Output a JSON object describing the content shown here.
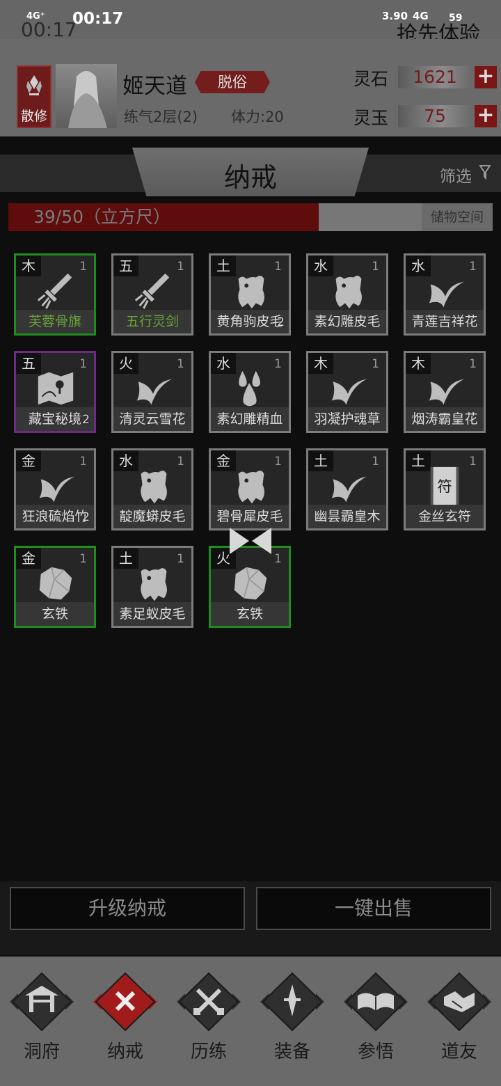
{
  "status_bar": {
    "signal": "4G⁺",
    "time": "00:17",
    "overlay_time": "00:17",
    "speed": "3.90",
    "network": "4G",
    "battery": "59",
    "banner": "抢先体验"
  },
  "player": {
    "sect": "散修",
    "name": "姬天道",
    "rank": "脱俗",
    "realm": "练气2层(2)",
    "stamina": "体力:20"
  },
  "currency": {
    "lingshi": {
      "label": "灵石",
      "value": "1621"
    },
    "lingyu": {
      "label": "灵玉",
      "value": "75"
    }
  },
  "ring": {
    "title": "纳戒",
    "filter_label": "筛选",
    "capacity_text": "39/50（立方尺）",
    "capacity_used": 39,
    "capacity_total": 50,
    "storage_label": "储物空间"
  },
  "items": [
    {
      "element": "木",
      "qty": "1",
      "name": "芙蓉骨旗",
      "icon": "sword-icon",
      "border": "green",
      "name_color": "green"
    },
    {
      "element": "五",
      "qty": "1",
      "name": "五行灵剑",
      "icon": "sword-icon",
      "border": "gray",
      "name_color": "green"
    },
    {
      "element": "土",
      "qty": "1",
      "name": "黄角驹皮毛",
      "icon": "pelt-icon",
      "border": "gray",
      "stack": "2"
    },
    {
      "element": "水",
      "qty": "1",
      "name": "素幻雕皮毛",
      "icon": "pelt-icon",
      "border": "gray"
    },
    {
      "element": "水",
      "qty": "1",
      "name": "青莲吉祥花",
      "icon": "leaf-icon",
      "border": "gray"
    },
    {
      "element": "五",
      "qty": "1",
      "name": "藏宝秘境",
      "icon": "map-icon",
      "border": "purple",
      "stack": "2"
    },
    {
      "element": "火",
      "qty": "1",
      "name": "清灵云雪花",
      "icon": "leaf-icon",
      "border": "gray"
    },
    {
      "element": "水",
      "qty": "1",
      "name": "素幻雕精血",
      "icon": "blood-icon",
      "border": "gray"
    },
    {
      "element": "木",
      "qty": "1",
      "name": "羽凝护魂草",
      "icon": "leaf-icon",
      "border": "gray"
    },
    {
      "element": "木",
      "qty": "1",
      "name": "烟涛霸皇花",
      "icon": "leaf-icon",
      "border": "gray"
    },
    {
      "element": "金",
      "qty": "1",
      "name": "狂浪硫焰竹",
      "icon": "leaf-icon",
      "border": "gray",
      "stack": "2"
    },
    {
      "element": "水",
      "qty": "1",
      "name": "靛魔蟒皮毛",
      "icon": "pelt-icon",
      "border": "gray"
    },
    {
      "element": "金",
      "qty": "1",
      "name": "碧骨犀皮毛",
      "icon": "pelt-icon",
      "border": "gray"
    },
    {
      "element": "土",
      "qty": "1",
      "name": "幽昙霸皇木",
      "icon": "leaf-icon",
      "border": "gray"
    },
    {
      "element": "土",
      "qty": "1",
      "name": "金丝玄符",
      "icon": "talisman-icon",
      "border": "gray",
      "talisman_char": "符"
    },
    {
      "element": "金",
      "qty": "1",
      "name": "玄铁",
      "icon": "ore-icon",
      "border": "green"
    },
    {
      "element": "土",
      "qty": "1",
      "name": "素足蚁皮毛",
      "icon": "pelt-icon",
      "border": "gray"
    },
    {
      "element": "火",
      "qty": "1",
      "name": "玄铁",
      "icon": "ore-icon",
      "border": "green"
    }
  ],
  "actions": {
    "upgrade": "升级纳戒",
    "sell_all": "一键出售"
  },
  "nav": [
    {
      "label": "洞府",
      "icon": "gate-icon",
      "active": false
    },
    {
      "label": "纳戒",
      "icon": "ring-icon",
      "active": true
    },
    {
      "label": "历练",
      "icon": "crossed-swords-icon",
      "active": false
    },
    {
      "label": "装备",
      "icon": "dagger-icon",
      "active": false
    },
    {
      "label": "参悟",
      "icon": "book-icon",
      "active": false
    },
    {
      "label": "道友",
      "icon": "handshake-icon",
      "active": false
    }
  ],
  "colors": {
    "accent_red": "#741d1d",
    "rare_green": "#1e8d1e",
    "epic_purple": "#6e2a8a",
    "panel_gray": "#6a6a6a"
  }
}
